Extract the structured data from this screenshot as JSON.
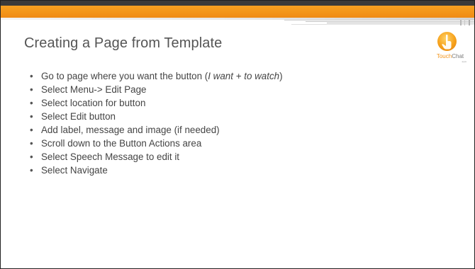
{
  "slide": {
    "title": "Creating a Page from Template",
    "logo": {
      "text_touch": "Touch",
      "text_chat": "Chat",
      "subtext": "apps",
      "icon": "hand-pointer-icon",
      "colors": {
        "orange": "#f39419",
        "grey": "#7a7a7a"
      }
    },
    "header_colors": {
      "dark": "#3a3a3a",
      "orange": "#f39419"
    },
    "bullets": [
      {
        "prefix": "Go to page where you want the button (",
        "emphasis": "I want + to watch",
        "suffix": ")"
      },
      {
        "text": "Select Menu-> Edit Page"
      },
      {
        "text": "Select location for button"
      },
      {
        "text": "Select Edit button"
      },
      {
        "text": "Add label, message and image (if needed)"
      },
      {
        "text": "Scroll down to the Button Actions area"
      },
      {
        "text": "Select Speech Message to edit it"
      },
      {
        "text": "Select Navigate"
      }
    ],
    "bullet_glyph": "•"
  }
}
